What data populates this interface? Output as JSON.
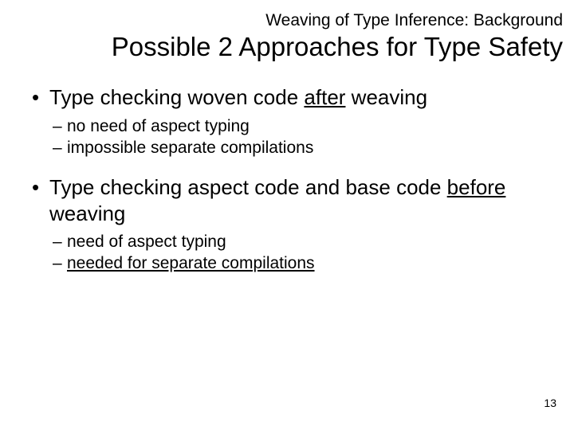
{
  "section_label": "Weaving of Type Inference: Background",
  "title": "Possible 2 Approaches for Type Safety",
  "bullets": [
    {
      "text_pre": "Type checking woven code ",
      "text_u": "after",
      "text_post": " weaving",
      "sub": [
        {
          "text": "no need of aspect typing"
        },
        {
          "text": "impossible separate compilations"
        }
      ]
    },
    {
      "text_pre": "Type checking aspect code and base code ",
      "text_u": "before",
      "text_post": " weaving",
      "sub": [
        {
          "text": "need of aspect typing"
        },
        {
          "text_u": "needed for separate compilations"
        }
      ]
    }
  ],
  "page_number": "13"
}
